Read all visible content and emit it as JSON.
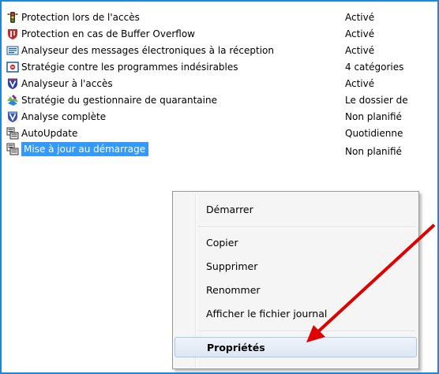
{
  "list": {
    "items": [
      {
        "name": "Protection lors de l'accès",
        "status": "Activé",
        "icon": "traffic-light-icon"
      },
      {
        "name": "Protection en cas de Buffer Overflow",
        "status": "Activé",
        "icon": "red-shield-icon"
      },
      {
        "name": "Analyseur des messages électroniques à la réception",
        "status": "Activé",
        "icon": "email-scanner-icon"
      },
      {
        "name": "Stratégie contre les programmes indésirables",
        "status": "4 catégories",
        "icon": "unwanted-programs-icon"
      },
      {
        "name": "Analyseur à l'accès",
        "status": "Activé",
        "icon": "shield-v-icon"
      },
      {
        "name": "Stratégie du gestionnaire de quarantaine",
        "status": "Le dossier de",
        "icon": "quarantine-icon"
      },
      {
        "name": "Analyse complète",
        "status": "Non planifié",
        "icon": "shield-v-icon"
      },
      {
        "name": "AutoUpdate",
        "status": "Quotidienne",
        "icon": "autoupdate-icon"
      },
      {
        "name": "Mise à jour au démarrage",
        "status": "Non planifié",
        "icon": "autoupdate-icon"
      }
    ]
  },
  "context_menu": {
    "start": "Démarrer",
    "copy": "Copier",
    "delete": "Supprimer",
    "rename": "Renommer",
    "show_log": "Afficher le fichier journal",
    "properties": "Propriétés"
  },
  "colors": {
    "selection": "#3399ff",
    "border": "#1e88d8",
    "annotation_arrow": "#e00000"
  }
}
